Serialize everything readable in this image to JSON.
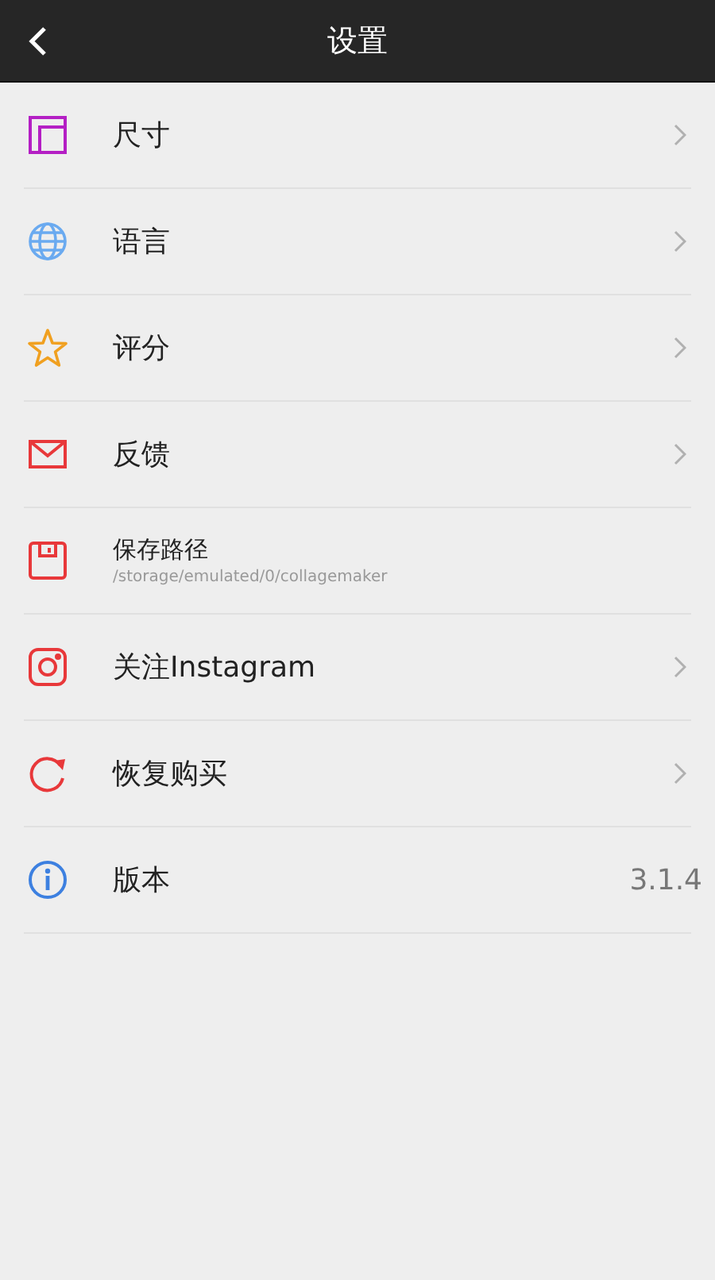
{
  "header": {
    "title": "设置"
  },
  "items": [
    {
      "kind": "link",
      "label": "尺寸"
    },
    {
      "kind": "link",
      "label": "语言"
    },
    {
      "kind": "link",
      "label": "评分"
    },
    {
      "kind": "link",
      "label": "反馈"
    },
    {
      "kind": "path",
      "label": "保存路径",
      "subtitle": "/storage/emulated/0/collagemaker"
    },
    {
      "kind": "link",
      "label": "关注Instagram"
    },
    {
      "kind": "link",
      "label": "恢复购买"
    },
    {
      "kind": "value",
      "label": "版本",
      "value": "3.1.4"
    }
  ]
}
